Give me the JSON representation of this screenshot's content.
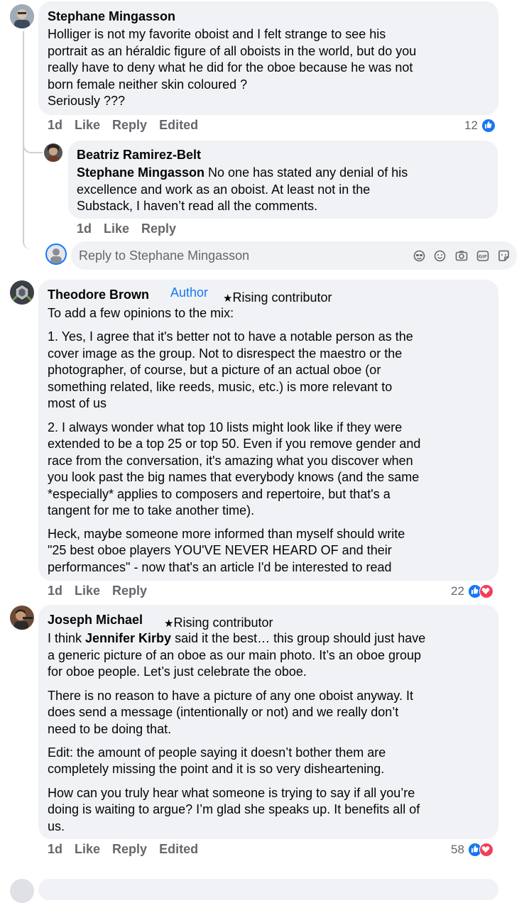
{
  "comments": [
    {
      "author": "Stephane Mingasson",
      "lines": [
        "Holliger is not my favorite oboist and I felt strange to see his",
        "portrait as an héraldic figure of all oboists in the world, but do you",
        "really have to deny what he did for the oboe because he was not",
        "born female neither skin coloured ?",
        "Seriously ???"
      ],
      "time": "1d",
      "like": "Like",
      "reply": "Reply",
      "edited": "Edited",
      "reaction_count": "12",
      "reactions": [
        "like"
      ]
    },
    {
      "author": "Beatriz Ramirez-Belt",
      "mention": "Stephane Mingasson",
      "lines": [
        " No one has stated any denial of his",
        "excellence and work as an oboist. At least not in the",
        "Substack, I haven’t read all the comments."
      ],
      "time": "1d",
      "like": "Like",
      "reply": "Reply"
    },
    {
      "author": "Theodore Brown",
      "author_tag": "Author",
      "badge": "Rising contributor",
      "paragraphs": [
        [
          "To add a few opinions to the mix:"
        ],
        [
          "1. Yes, I agree that it's better not to have a notable person as the",
          "cover image as the group. Not to disrespect the maestro or the",
          "photographer, of course, but a picture of an actual oboe (or",
          "something related, like reeds, music, etc.) is more relevant to",
          "most of us"
        ],
        [
          "2. I always wonder what top 10 lists might look like if they were",
          "extended to be a top 25 or top 50. Even if you remove gender and",
          "race from the conversation, it's amazing what you discover when",
          "you look past the big names that everybody knows (and the same",
          "*especially* applies to composers and repertoire, but that's a",
          "tangent for me to take another time)."
        ],
        [
          "Heck, maybe someone more informed than myself should write",
          "\"25 best oboe players YOU'VE NEVER HEARD OF and their",
          "performances\" - now that's an article I'd be interested to read"
        ]
      ],
      "time": "1d",
      "like": "Like",
      "reply": "Reply",
      "reaction_count": "22",
      "reactions": [
        "like",
        "love"
      ]
    },
    {
      "author": "Joseph Michael",
      "badge": "Rising contributor",
      "first_line_pre": "I think ",
      "first_line_mention": "Jennifer Kirby",
      "first_line_post": " said it the best… this group should just have",
      "paragraphs": [
        [
          "a generic picture of an oboe as our main photo. It’s an oboe group",
          "for oboe people. Let’s just celebrate the oboe."
        ],
        [
          "There is no reason to have a picture of any one oboist anyway. It",
          "does send a message (intentionally or not) and we really don’t",
          "need to be doing that."
        ],
        [
          "Edit: the amount of people saying it doesn’t bother them are",
          "completely missing the point and it is so very disheartening."
        ],
        [
          "How can you truly hear what someone is trying to say if all you’re",
          "doing is waiting to argue? I’m glad she speaks up. It benefits all of",
          "us."
        ]
      ],
      "time": "1d",
      "like": "Like",
      "reply": "Reply",
      "edited": "Edited",
      "reaction_count": "58",
      "reactions": [
        "like",
        "love"
      ]
    }
  ],
  "reply_box": {
    "placeholder": "Reply to Stephane Mingasson",
    "icons": [
      "avatar-sticker-icon",
      "emoji-icon",
      "camera-icon",
      "gif-icon",
      "sticker-icon"
    ]
  },
  "colors": {
    "bubble": "#f0f2f5",
    "action_text": "#65676b",
    "accent": "#1877f2",
    "love": "#f33e58"
  }
}
